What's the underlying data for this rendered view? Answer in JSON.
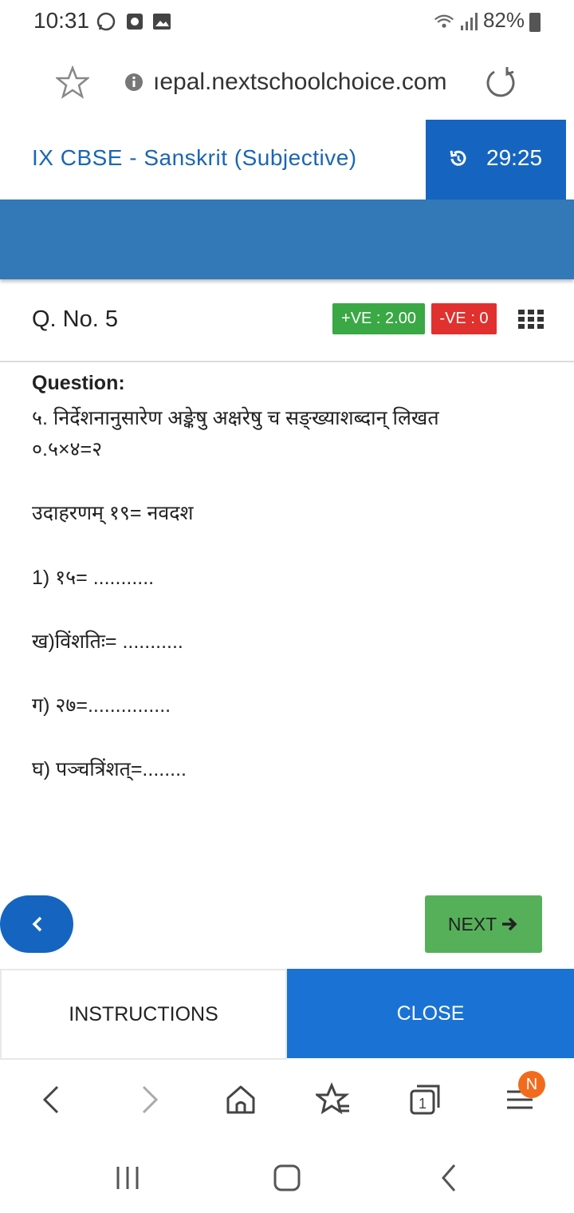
{
  "status_bar": {
    "time": "10:31",
    "battery": "82%",
    "icons": [
      "whatsapp-icon",
      "notification-icon",
      "gallery-icon",
      "wifi-icon",
      "signal-icon",
      "battery-icon"
    ]
  },
  "browser": {
    "url": "ıepal.nextschoolchoice.com",
    "icons": [
      "star-icon",
      "info-icon",
      "reload-icon"
    ]
  },
  "header": {
    "title": "IX CBSE - Sanskrit (Subjective)",
    "timer": "29:25"
  },
  "question": {
    "number": "Q. No. 5",
    "positive_marks": "+VE : 2.00",
    "negative_marks": "-VE : 0",
    "label": "Question:",
    "lines": [
      "५. निर्देशनानुसारेण अङ्केषु अक्षरेषु च सङ्ख्याशब्दान् लिखत",
      "०.५×४=२",
      "उदाहरणम् १९= नवदश",
      "1) १५= ...........",
      "ख)विंशतिः= ...........",
      "ग) २७=...............",
      "घ) पञ्चत्रिंशत्=........"
    ]
  },
  "navigation": {
    "next_label": "NEXT"
  },
  "footer": {
    "instructions_label": "INSTRUCTIONS",
    "close_label": "CLOSE"
  },
  "browser_nav": {
    "tabs_count": "1",
    "menu_badge": "N"
  },
  "colors": {
    "primary_blue": "#1565c0",
    "band_blue": "#3378b7",
    "positive_green": "#3aa845",
    "negative_red": "#e0312f",
    "next_green": "#56b05a",
    "badge_orange": "#f26b1d"
  }
}
